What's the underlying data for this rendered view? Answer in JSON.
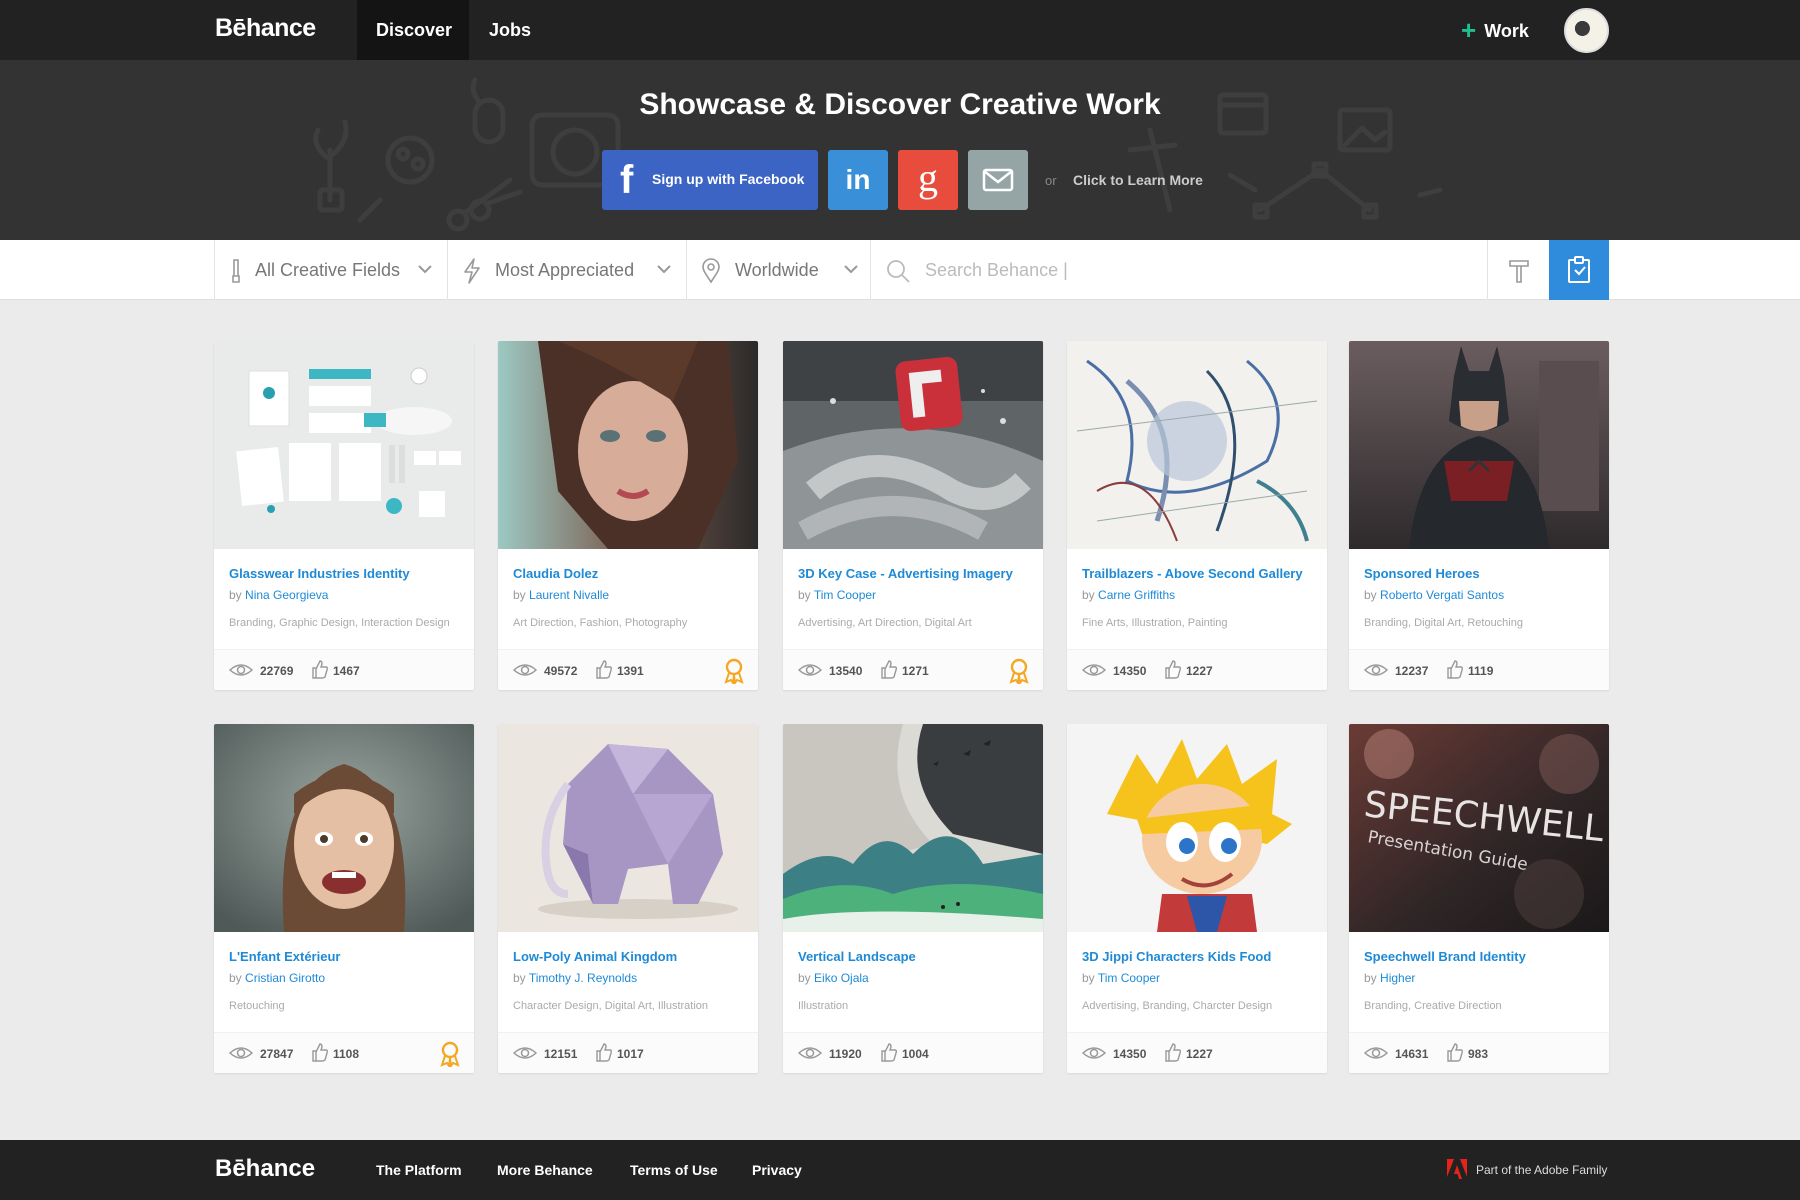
{
  "nav": {
    "logo": "Bēhance",
    "tabs": [
      {
        "label": "Discover"
      },
      {
        "label": "Jobs"
      }
    ],
    "work_label": "Work"
  },
  "hero": {
    "title": "Showcase & Discover Creative Work",
    "facebook_label": "Sign up with Facebook",
    "linkedin_label": "in",
    "google_label": "g",
    "or_label": "or",
    "learn_more": "Click to Learn More"
  },
  "filters": {
    "fields": "All Creative Fields",
    "sort": "Most Appreciated",
    "location": "Worldwide",
    "search_placeholder": "Search Behance |"
  },
  "colors": {
    "accent_blue": "#1e8ad6",
    "facebook": "#3b64c4",
    "linkedin": "#3a90d8",
    "google": "#e74c3c",
    "email": "#95a5a6",
    "award": "#f5a623"
  },
  "projects": [
    {
      "title": "Glasswear Industries Identity",
      "by": "by",
      "author": "Nina Georgieva",
      "fields": "Branding, Graphic Design, Interaction Design",
      "views": "22769",
      "likes": "1467",
      "featured": false
    },
    {
      "title": "Claudia Dolez",
      "by": "by",
      "author": "Laurent Nivalle",
      "fields": "Art Direction, Fashion, Photography",
      "views": "49572",
      "likes": "1391",
      "featured": true
    },
    {
      "title": "3D Key Case - Advertising Imagery",
      "by": "by",
      "author": "Tim Cooper",
      "fields": "Advertising, Art Direction, Digital Art",
      "views": "13540",
      "likes": "1271",
      "featured": true
    },
    {
      "title": "Trailblazers - Above Second Gallery",
      "by": "by",
      "author": "Carne Griffiths",
      "fields": "Fine Arts, Illustration, Painting",
      "views": "14350",
      "likes": "1227",
      "featured": false
    },
    {
      "title": "Sponsored Heroes",
      "by": "by",
      "author": "Roberto Vergati Santos",
      "fields": "Branding, Digital Art, Retouching",
      "views": "12237",
      "likes": "1119",
      "featured": false
    },
    {
      "title": "L'Enfant Extérieur",
      "by": "by",
      "author": "Cristian Girotto",
      "fields": "Retouching",
      "views": "27847",
      "likes": "1108",
      "featured": true
    },
    {
      "title": "Low-Poly Animal Kingdom",
      "by": "by",
      "author": "Timothy J. Reynolds",
      "fields": "Character Design, Digital Art, Illustration",
      "views": "12151",
      "likes": "1017",
      "featured": false
    },
    {
      "title": "Vertical Landscape",
      "by": "by",
      "author": "Eiko Ojala",
      "fields": "Illustration",
      "views": "11920",
      "likes": "1004",
      "featured": false
    },
    {
      "title": "3D Jippi Characters Kids Food",
      "by": "by",
      "author": "Tim Cooper",
      "fields": "Advertising, Branding, Charcter Design",
      "views": "14350",
      "likes": "1227",
      "featured": false
    },
    {
      "title": "Speechwell Brand Identity",
      "by": "by",
      "author": "Higher",
      "fields": "Branding, Creative Direction",
      "views": "14631",
      "likes": "983",
      "featured": false
    }
  ],
  "thumb_text": {
    "speechwell_main": "SPEECHWELL",
    "speechwell_sub": "Presentation Guide"
  },
  "footer": {
    "logo": "Bēhance",
    "links": [
      {
        "label": "The Platform"
      },
      {
        "label": "More Behance"
      },
      {
        "label": "Terms of Use"
      },
      {
        "label": "Privacy"
      }
    ],
    "adobe": "Part of the Adobe Family"
  }
}
